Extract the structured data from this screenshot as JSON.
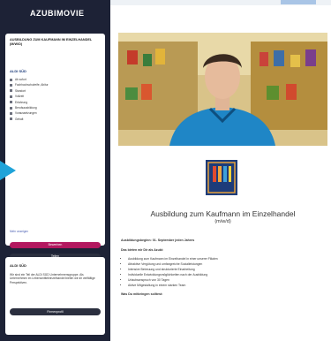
{
  "brand": {
    "logo_text": "AZUBIMOVIE"
  },
  "job": {
    "title": "AUSBILDUNG ZUM KAUFMANN IM EINZELHANDEL (M/W/D)",
    "company": "ALDI SÜD",
    "details": [
      "Ab sofort",
      "Fachhochschulreife, Abitur",
      "Standort",
      "Vollzeit",
      "Erfahrung",
      "Berufsausbildung",
      "Voraussetzungen",
      "Gehalt"
    ],
    "more_link": "Mehr anzeigen",
    "apply_label": "Bewerben",
    "share_label": "Teilen",
    "back_link": "Zurück"
  },
  "company_box": {
    "title": "ALDI SÜD",
    "text": "Wir sind ein Teil der ALDI SÜD Unternehmensgruppe. Als Unternehmen im Lebensmitteleinzelhandel bieten wir dir vielfältige Perspektiven.",
    "button_label": "Firmenprofil"
  },
  "main": {
    "title": "Ausbildung zum Kaufmann im Einzelhandel",
    "subtitle": "(m/w/d)",
    "logo_text": "ALDI SÜD",
    "intro": "Ausbildungsbeginn: 01. September jeden Jahres",
    "section_heading": "Das bieten wir Dir als Azubi:",
    "bullets": [
      "Ausbildung zum Kaufmann im Einzelhandel in einer unserer Filialen",
      "Attraktive Vergütung und umfangreiche Sozialleistungen",
      "Intensive Betreuung und strukturierte Einarbeitung",
      "Individuelle Entwicklungsmöglichkeiten nach der Ausbildung",
      "Urlaubsanspruch von 30 Tagen",
      "Aktive Mitgestaltung in einem starken Team"
    ],
    "footer_heading": "Was Du mitbringen solltest:"
  }
}
